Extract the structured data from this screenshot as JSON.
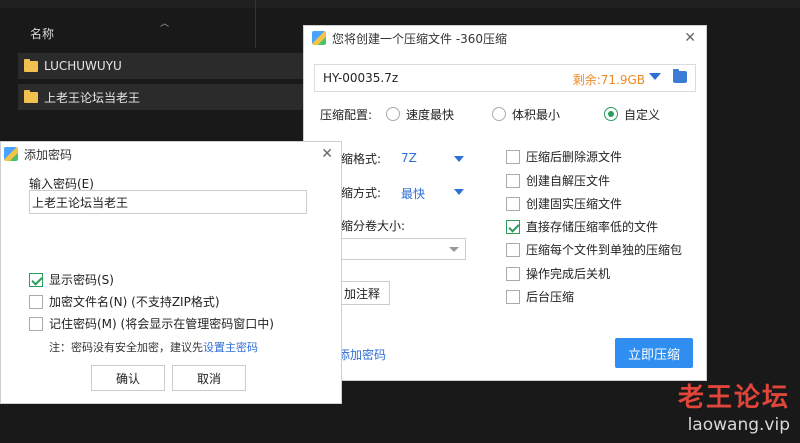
{
  "explorer": {
    "column_header": "名称",
    "rows": [
      {
        "name": "LUCHUWUYU"
      },
      {
        "name": "上老王论坛当老王"
      }
    ]
  },
  "compress_dialog": {
    "title": "您将创建一个压缩文件 -360压缩",
    "archive_name": "HY-00035.7z",
    "free_space": "剩余:71.9GB",
    "profile_label": "压缩配置:",
    "profiles": [
      {
        "label": "速度最快",
        "selected": false
      },
      {
        "label": "体积最小",
        "selected": false
      },
      {
        "label": "自定义",
        "selected": true
      }
    ],
    "format_label": "缩格式:",
    "format_value": "7Z",
    "method_label": "缩方式:",
    "method_value": "最快",
    "volume_label": "缩分卷大小:",
    "note_button": "加注释",
    "add_password_link": "添加密码",
    "compress_button": "立即压缩",
    "options": [
      {
        "label": "压缩后删除源文件",
        "checked": false
      },
      {
        "label": "创建自解压文件",
        "checked": false
      },
      {
        "label": "创建固实压缩文件",
        "checked": false
      },
      {
        "label": "直接存储压缩率低的文件",
        "checked": true
      },
      {
        "label": "压缩每个文件到单独的压缩包",
        "checked": false
      },
      {
        "label": "操作完成后关机",
        "checked": false
      },
      {
        "label": "后台压缩",
        "checked": false
      }
    ]
  },
  "password_dialog": {
    "title": "添加密码",
    "input_label": "输入密码(E)",
    "password_value": "上老王论坛当老王",
    "options": [
      {
        "label": "显示密码(S)",
        "checked": true
      },
      {
        "label": "加密文件名(N) (不支持ZIP格式)",
        "checked": false
      },
      {
        "label": "记住密码(M) (将会显示在管理密码窗口中)",
        "checked": false
      }
    ],
    "note_text": "注：密码没有安全加密，建议先",
    "note_link": "设置主密码",
    "ok_button": "确认",
    "cancel_button": "取消"
  },
  "watermark": {
    "text_cn": "老王论坛",
    "text_en": "laowang.vip"
  },
  "colors": {
    "accent_blue": "#2f8ef0",
    "free_space_orange": "#f08a24",
    "check_green": "#2a9d5c",
    "watermark_red": "#e0453a"
  }
}
